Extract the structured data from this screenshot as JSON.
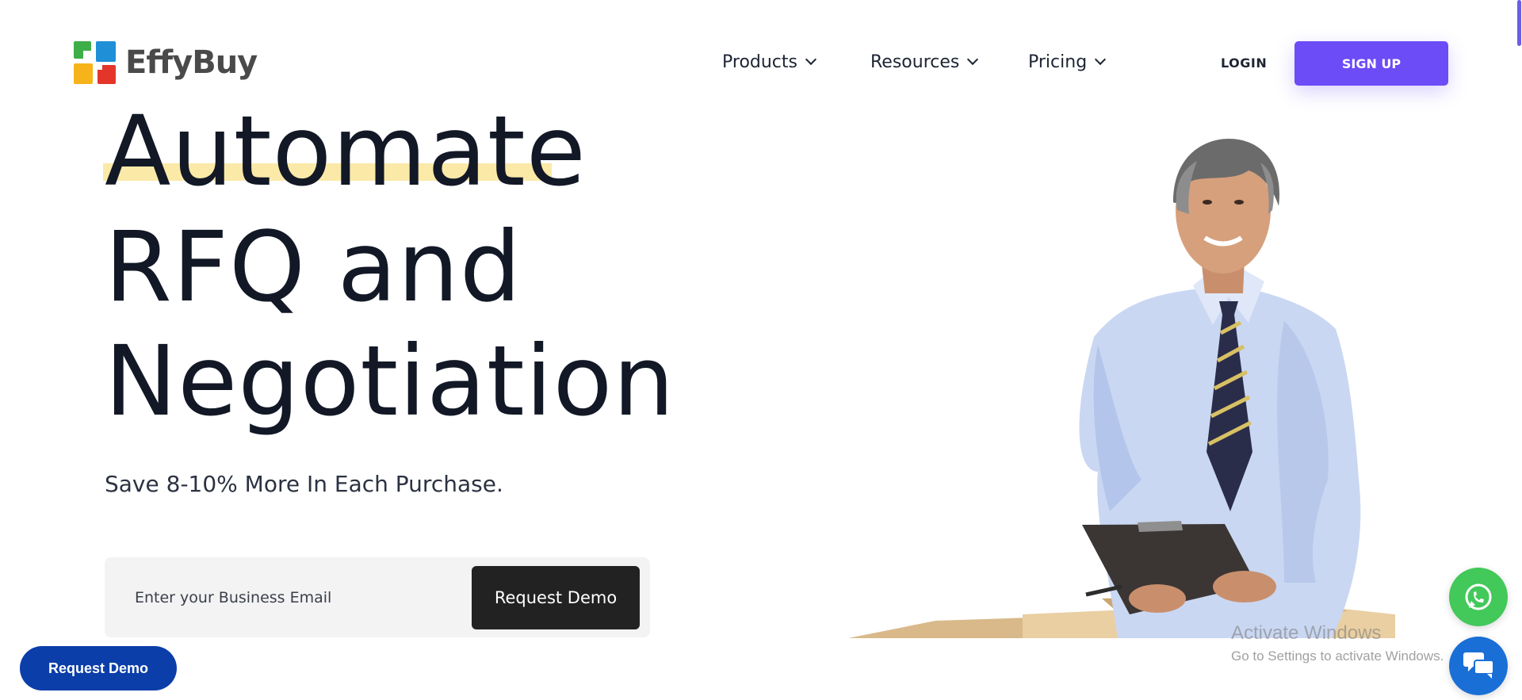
{
  "brand": {
    "name": "EffyBuy"
  },
  "nav": {
    "items": [
      {
        "label": "Products"
      },
      {
        "label": "Resources"
      },
      {
        "label": "Pricing"
      }
    ],
    "login_label": "LOGIN",
    "signup_label": "SIGN UP"
  },
  "hero": {
    "line1": "Automate",
    "line2": "RFQ and",
    "line3": "Negotiation",
    "subtitle": "Save 8-10% More In Each Purchase.",
    "email_placeholder": "Enter your Business Email",
    "cta_label": "Request Demo"
  },
  "floating": {
    "request_demo_label": "Request Demo"
  },
  "overlay": {
    "activate_title": "Activate Windows",
    "activate_sub": "Go to Settings to activate Windows."
  },
  "colors": {
    "accent": "#6c4cf7",
    "highlight": "#fbe9a8",
    "dark_button": "#222222",
    "floating_button": "#0b3ea8",
    "whatsapp": "#43c85a",
    "chat": "#1a6fd6"
  },
  "icons": [
    "chevron-down-icon",
    "whatsapp-icon",
    "chat-icon"
  ]
}
